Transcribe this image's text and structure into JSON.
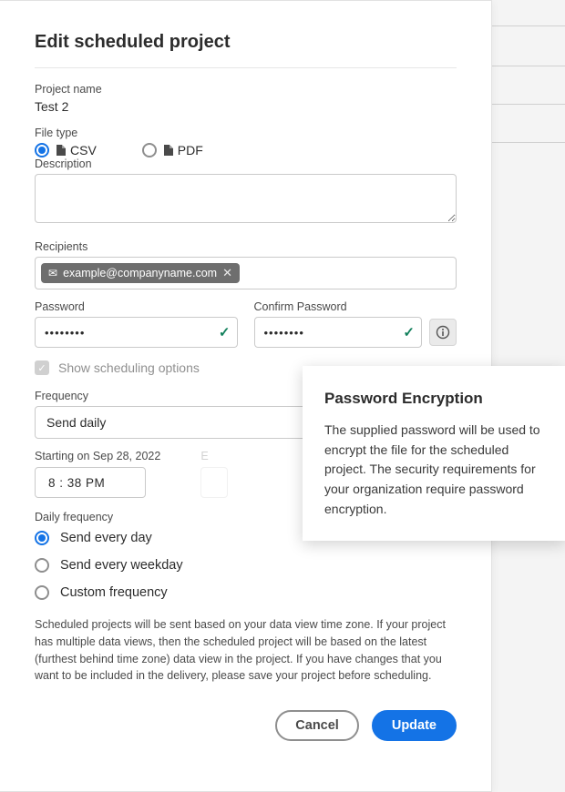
{
  "dialog": {
    "title": "Edit scheduled project",
    "projectNameLabel": "Project name",
    "projectName": "Test 2",
    "fileTypeLabel": "File type",
    "fileTypes": {
      "csv": "CSV",
      "pdf": "PDF",
      "selected": "csv"
    },
    "descriptionLabel": "Description",
    "description": "",
    "recipientsLabel": "Recipients",
    "recipients": [
      "example@companyname.com"
    ],
    "passwordLabel": "Password",
    "confirmPasswordLabel": "Confirm Password",
    "passwordMasked": "••••••••",
    "confirmMasked": "••••••••",
    "showSchedulingLabel": "Show scheduling options",
    "frequencyLabel": "Frequency",
    "frequencyValue": "Send daily",
    "startingLabel": "Starting on Sep 28, 2022",
    "startingTime": "8 : 38   PM",
    "endingLabel": "E",
    "endingTime": "",
    "dailyFrequencyLabel": "Daily frequency",
    "dailyOptions": {
      "everyday": "Send every day",
      "weekday": "Send every weekday",
      "custom": "Custom frequency",
      "selected": "everyday"
    },
    "note": "Scheduled projects will be sent based on your data view time zone. If your project has multiple data views, then the scheduled project will be based on the latest (furthest behind time zone) data view in the project. If you have changes that you want to be included in the delivery, please save your project before scheduling.",
    "cancelLabel": "Cancel",
    "updateLabel": "Update"
  },
  "tooltip": {
    "title": "Password Encryption",
    "body": "The supplied password will be used to encrypt the file for the scheduled project. The security requirements for your organization require password encryption."
  }
}
